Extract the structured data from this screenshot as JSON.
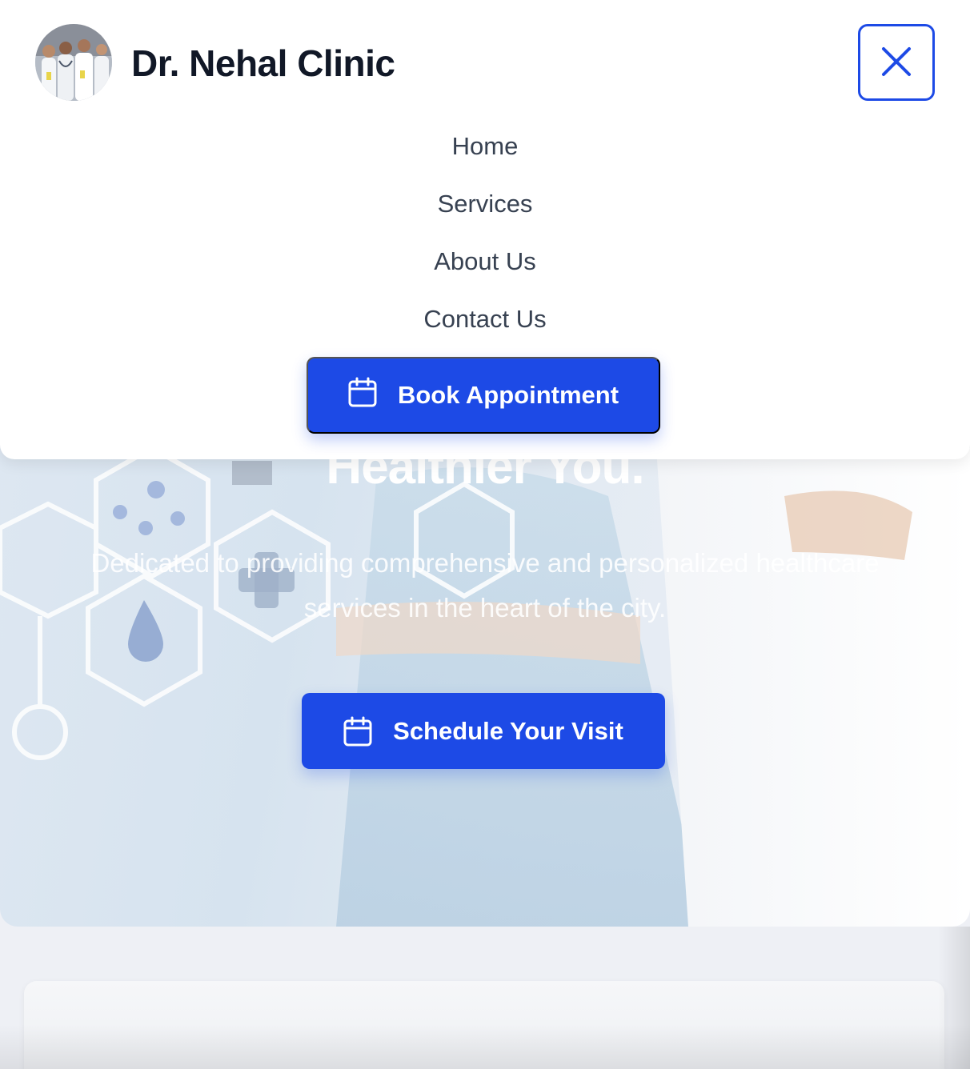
{
  "header": {
    "brand_name": "Dr. Nehal Clinic",
    "logo_icon": "clinic-doctors-photo",
    "close_icon": "close-icon"
  },
  "nav": {
    "items": [
      {
        "label": "Home"
      },
      {
        "label": "Services"
      },
      {
        "label": "About Us"
      },
      {
        "label": "Contact Us"
      }
    ],
    "book_button": {
      "label": "Book Appointment",
      "icon": "calendar-icon"
    }
  },
  "hero": {
    "title_partial": "Healthier You.",
    "subtitle": "Dedicated to providing comprehensive and personalized healthcare services in the heart of the city.",
    "cta": {
      "label": "Schedule Your Visit",
      "icon": "calendar-icon"
    }
  },
  "colors": {
    "accent": "#1d4ae6",
    "brand_text": "#111827",
    "nav_text": "#374151"
  }
}
